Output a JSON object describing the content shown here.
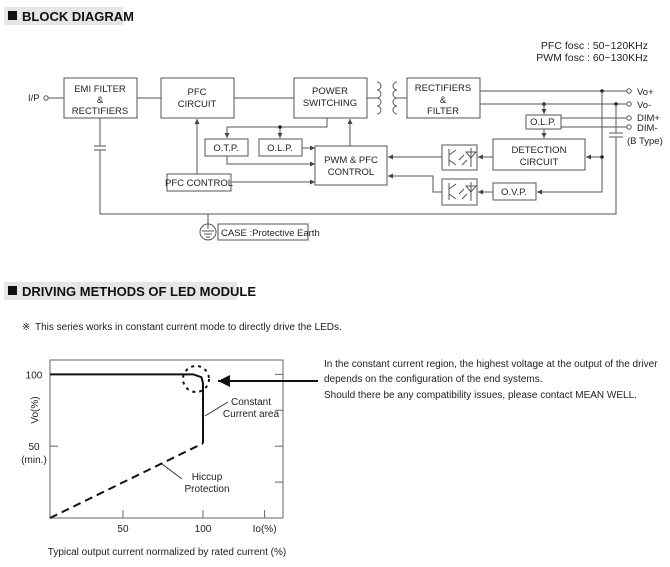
{
  "block_diagram": {
    "heading": "BLOCK DIAGRAM",
    "spec_lines": [
      "PFC fosc : 50~120KHz",
      "PWM fosc : 60~130KHz"
    ],
    "input_label": "I/P",
    "blocks": {
      "emi": [
        "EMI FILTER",
        "&",
        "RECTIFIERS"
      ],
      "pfc_circuit": [
        "PFC",
        "CIRCUIT"
      ],
      "power_switching": [
        "POWER",
        "SWITCHING"
      ],
      "rectifiers_filter": [
        "RECTIFIERS",
        "&",
        "FILTER"
      ],
      "otp": "O.T.P.",
      "olp_left": "O.L.P.",
      "pwm_pfc_control": [
        "PWM & PFC",
        "CONTROL"
      ],
      "pfc_control": "PFC CONTROL",
      "detection": [
        "DETECTION",
        "CIRCUIT"
      ],
      "olp_right": "O.L.P.",
      "ovp": "O.V.P."
    },
    "outputs": [
      "Vo+",
      "Vo-",
      "DIM+",
      "DIM-",
      "(B Type)"
    ],
    "case_label": "CASE :Protective Earth"
  },
  "driving": {
    "heading": "DRIVING METHODS OF LED MODULE",
    "note_symbol": "※",
    "note": "This series works in constant current mode to directly drive the LEDs.",
    "callout": [
      "In the constant current region, the highest voltage at the output of the driver",
      "depends on the configuration of the end systems.",
      "Should there be any compatibility issues, please contact MEAN WELL."
    ]
  },
  "chart_data": {
    "type": "line",
    "title": "",
    "xlabel": "Io(%)",
    "ylabel": "Vo(%)",
    "caption": "Typical output current normalized by rated current (%)",
    "xlim": [
      4.4,
      150
    ],
    "ylim": [
      0,
      110
    ],
    "x_ticks": [
      {
        "value": 50,
        "label": "50"
      },
      {
        "value": 100,
        "label": "100"
      },
      {
        "value": 138.5,
        "label": "Io(%)"
      }
    ],
    "y_ticks": [
      {
        "value": 100,
        "label": "100"
      },
      {
        "value": 50,
        "label": "50",
        "sublabel": "(min.)"
      }
    ],
    "grid": false,
    "series": [
      {
        "style": "solid",
        "points": [
          [
            4.4,
            100
          ],
          [
            94,
            100
          ],
          [
            99,
            98
          ],
          [
            100,
            94
          ],
          [
            100,
            52
          ]
        ]
      },
      {
        "style": "dashed",
        "points": [
          [
            4.4,
            0
          ],
          [
            100,
            52
          ]
        ]
      }
    ],
    "annotations": [
      {
        "text": [
          "Constant",
          "Current area"
        ]
      },
      {
        "text": [
          "Hiccup",
          "Protection"
        ]
      }
    ]
  }
}
